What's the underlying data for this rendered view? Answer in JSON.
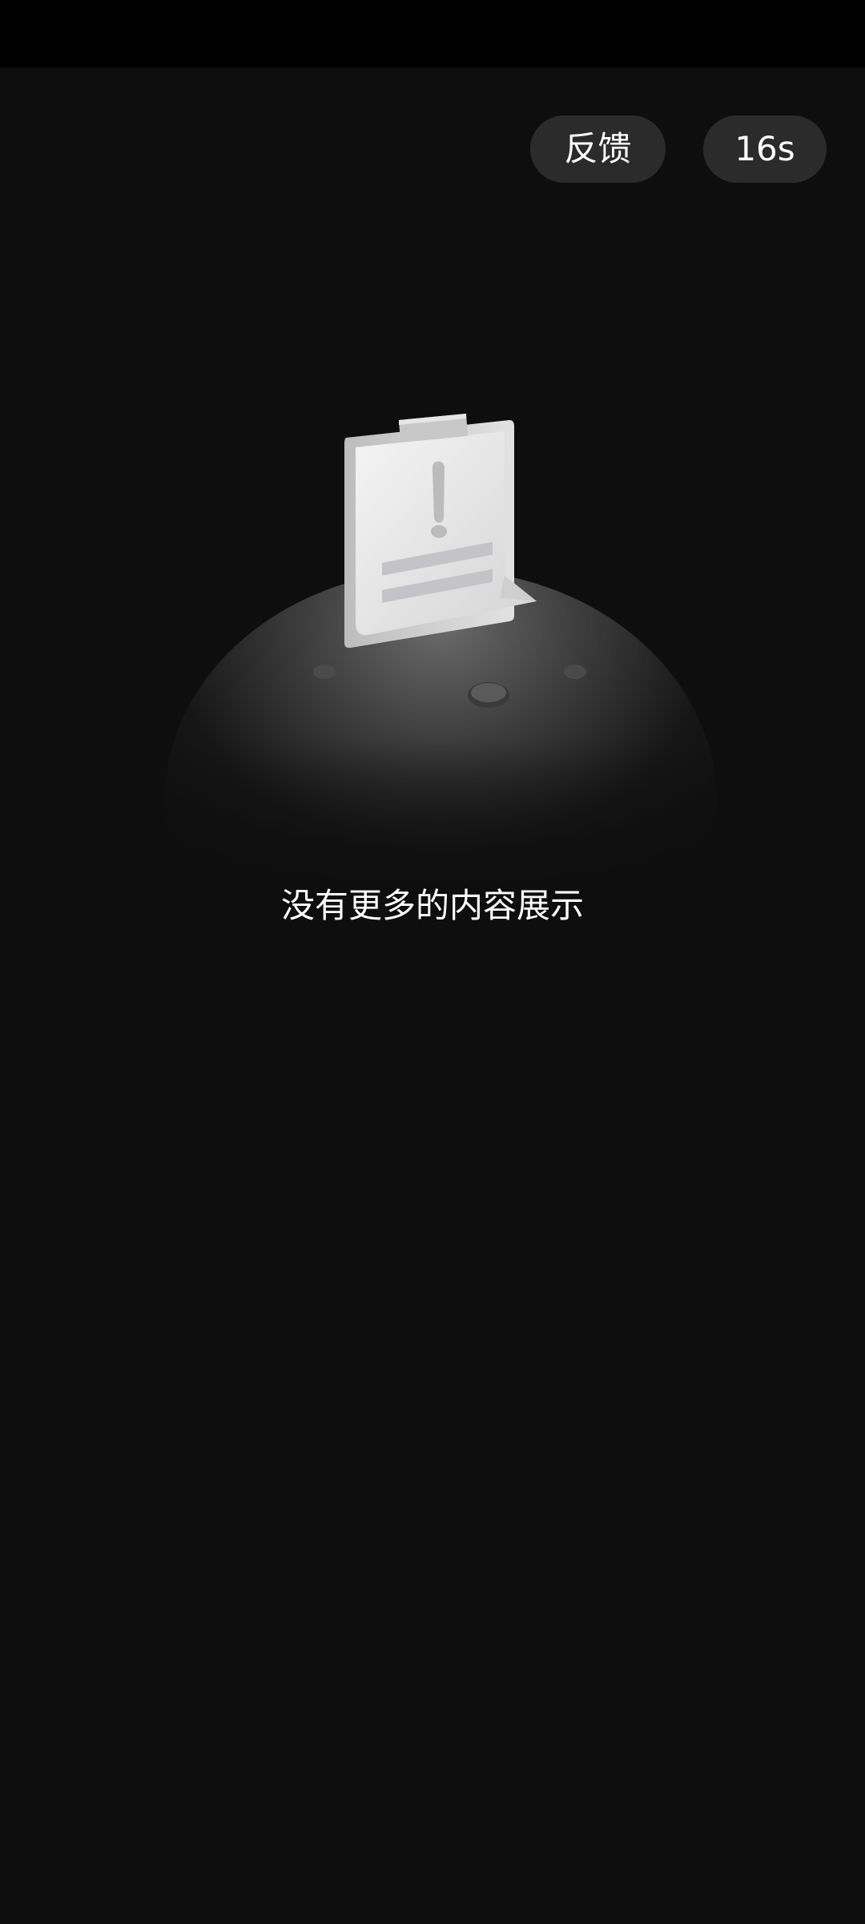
{
  "header": {
    "feedback_label": "反馈",
    "countdown_label": "16s"
  },
  "empty_state": {
    "message": "没有更多的内容展示",
    "illustration_icon": "clipboard-warning-icon"
  },
  "colors": {
    "background": "#0e0e0e",
    "status_bar": "#000000",
    "pill_background": "#2b2b2b",
    "text": "#ffffff"
  }
}
